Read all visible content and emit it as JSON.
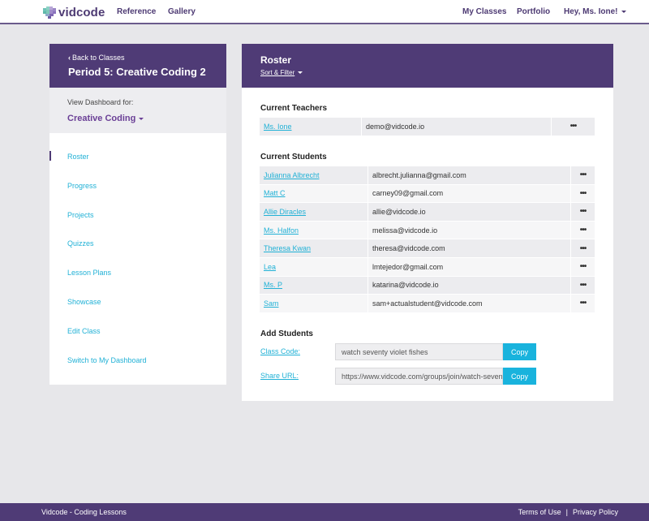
{
  "nav": {
    "logo_text": "vidcode",
    "links": [
      "Reference",
      "Gallery"
    ],
    "right_links": [
      "My Classes",
      "Portfolio"
    ],
    "user_menu": "Hey, Ms. Ione!"
  },
  "sidebar": {
    "back_label": "Back to Classes",
    "class_title": "Period 5: Creative Coding 2",
    "dashboard_label": "View Dashboard for:",
    "dashboard_value": "Creative Coding",
    "items": [
      {
        "label": "Roster"
      },
      {
        "label": "Progress"
      },
      {
        "label": "Projects"
      },
      {
        "label": "Quizzes"
      },
      {
        "label": "Lesson Plans"
      },
      {
        "label": "Showcase"
      },
      {
        "label": "Edit Class"
      },
      {
        "label": "Switch to My Dashboard"
      }
    ]
  },
  "main": {
    "title": "Roster",
    "sort_filter": "Sort & Filter",
    "teachers_heading": "Current Teachers",
    "teachers": [
      {
        "name": "Ms. Ione",
        "email": "demo@vidcode.io",
        "more": "•••"
      }
    ],
    "students_heading": "Current Students",
    "students": [
      {
        "name": "Julianna Albrecht",
        "email": "albrecht.julianna@gmail.com",
        "more": "•••"
      },
      {
        "name": "Matt C",
        "email": "carney09@gmail.com",
        "more": "•••"
      },
      {
        "name": "Allie Diracles",
        "email": "allie@vidcode.io",
        "more": "•••"
      },
      {
        "name": "Ms. Halfon",
        "email": "melissa@vidcode.io",
        "more": "•••"
      },
      {
        "name": "Theresa Kwan",
        "email": "theresa@vidcode.com",
        "more": "•••"
      },
      {
        "name": "Lea",
        "email": "lmtejedor@gmail.com",
        "more": "•••"
      },
      {
        "name": "Ms. P",
        "email": "katarina@vidcode.io",
        "more": "•••"
      },
      {
        "name": "Sam",
        "email": "sam+actualstudent@vidcode.com",
        "more": "•••"
      }
    ],
    "add_heading": "Add Students",
    "class_code_label": "Class Code:",
    "class_code_value": "watch seventy violet fishes",
    "share_url_label": "Share URL:",
    "share_url_value": "https://www.vidcode.com/groups/join/watch-seventy-violet-fishes",
    "copy_label": "Copy"
  },
  "footer": {
    "left": "Vidcode - Coding Lessons",
    "terms": "Terms of Use",
    "separator": "|",
    "privacy": "Privacy Policy"
  },
  "colors": {
    "brand_purple": "#4f3b76",
    "link_blue": "#21b1d6",
    "copy_button": "#19b3dd"
  }
}
